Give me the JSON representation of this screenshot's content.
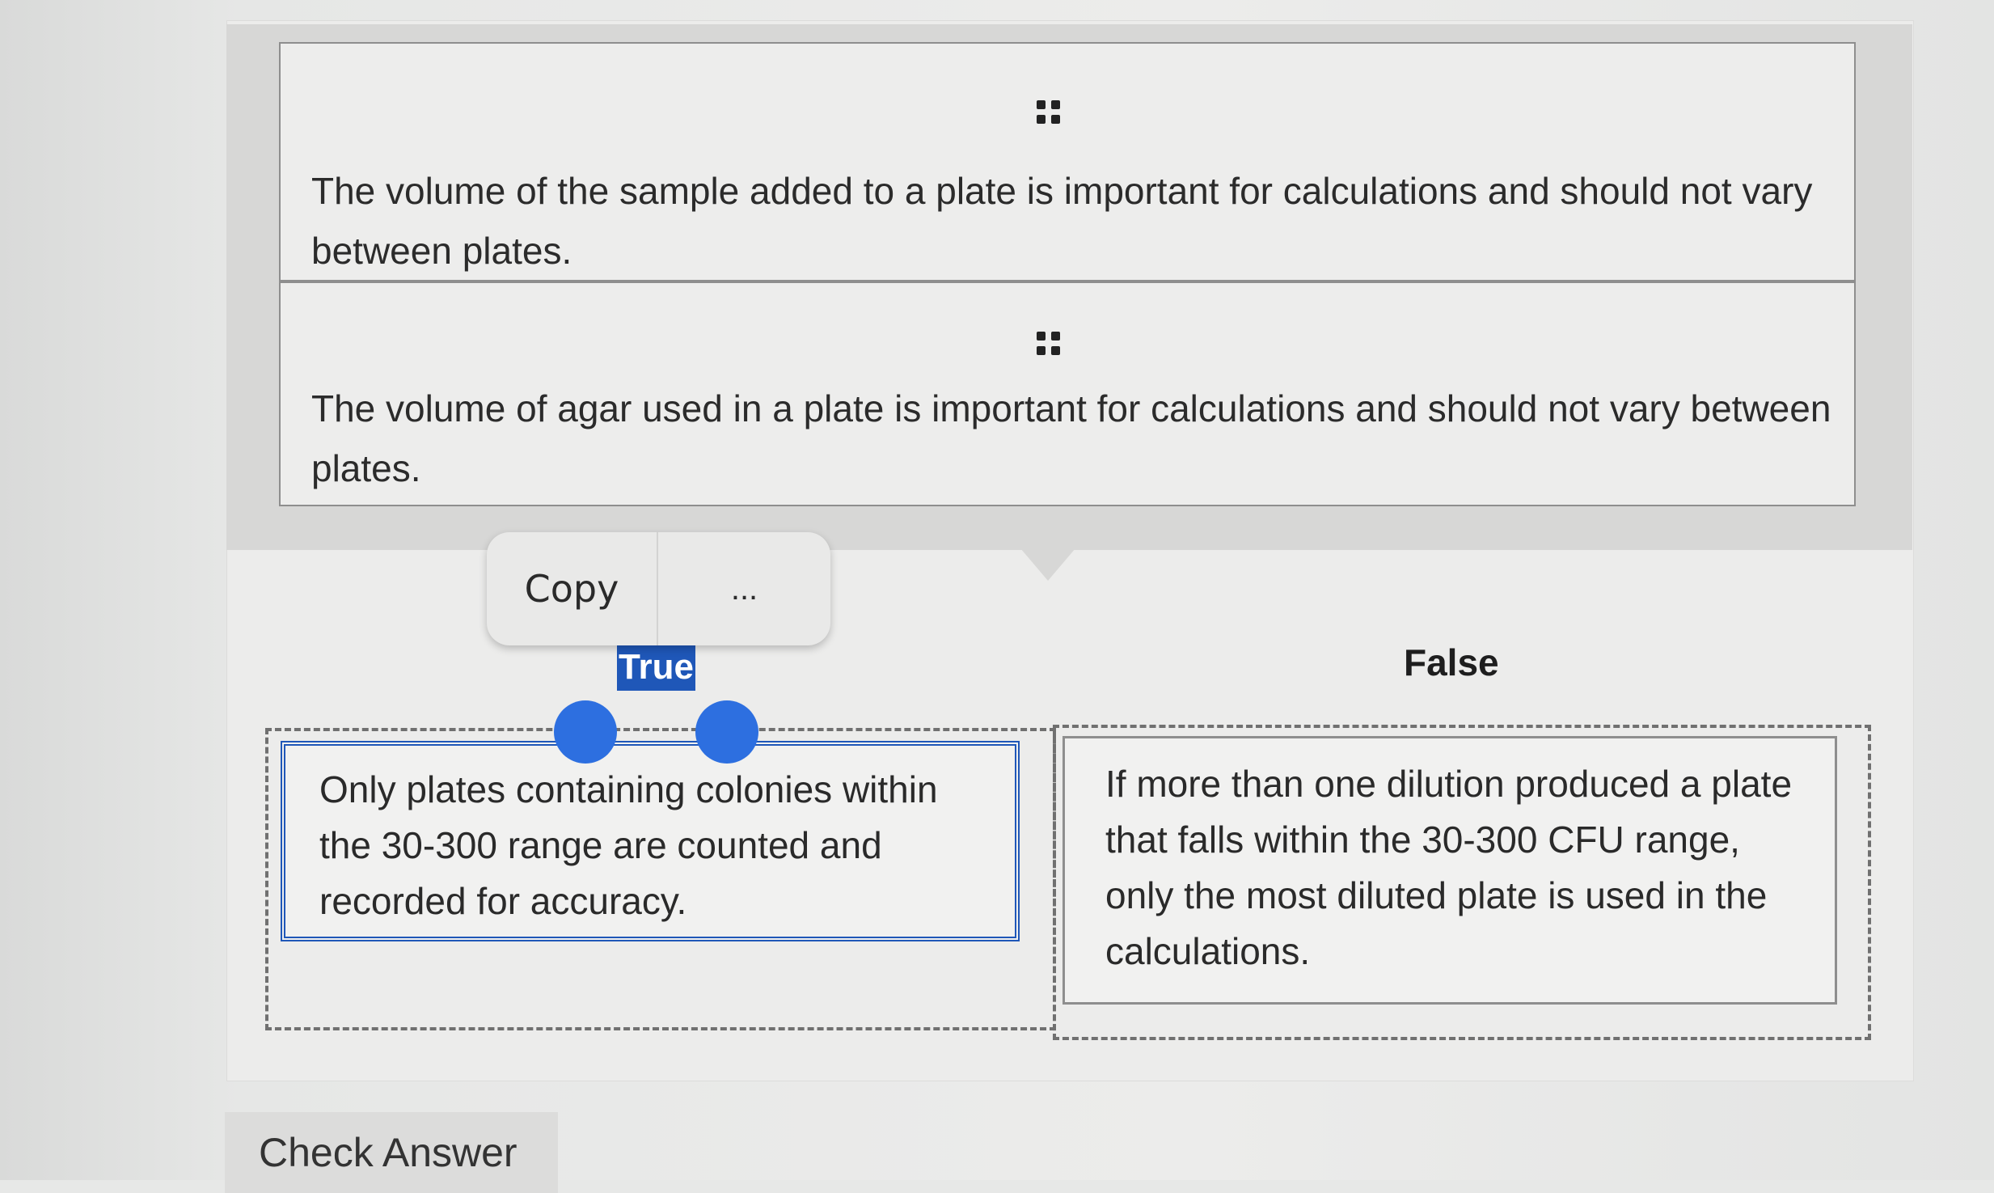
{
  "items_bank": [
    {
      "text": "The volume of the sample added to a plate is important for calculations and should not vary between plates."
    },
    {
      "text": "The volume of agar used in a plate is important for calculations and should not vary between plates."
    }
  ],
  "context_menu": {
    "copy_label": "Copy",
    "more_label": "..."
  },
  "categories": {
    "true_label": "True",
    "false_label": "False"
  },
  "true_zone": {
    "cards": [
      {
        "text": "Only plates containing colonies within the 30-300 range are counted and recorded for accuracy."
      }
    ]
  },
  "false_zone": {
    "cards": [
      {
        "text": "If more than one dilution produced a plate that falls within the 30-300 CFU range, only the most diluted plate is used in the calculations."
      }
    ]
  },
  "check_answer_label": "Check Answer",
  "colors": {
    "selection_blue": "#1f57b8",
    "handle_blue": "#2d6fe0"
  }
}
